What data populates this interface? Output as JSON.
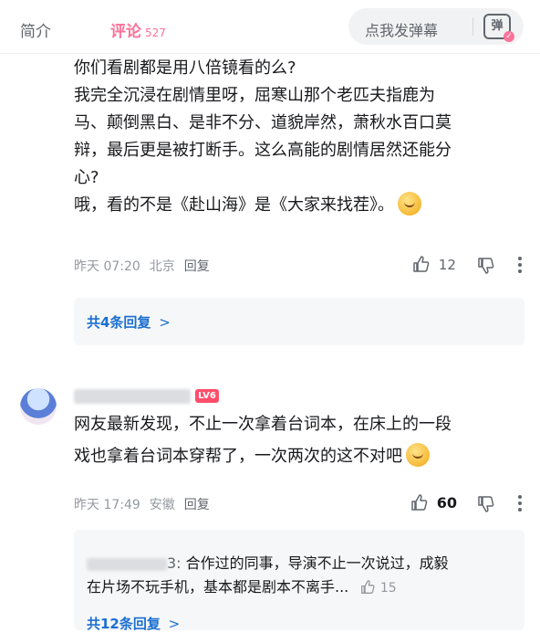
{
  "tabs": {
    "intro": "简介",
    "comments": "评论",
    "comments_count": "527"
  },
  "danmaku": {
    "prompt": "点我发弹幕",
    "icon_label": "弹"
  },
  "comment1": {
    "lines": [
      "你们看剧都是用八倍镜看的么?",
      "我完全沉浸在剧情里呀，屈寒山那个老匹夫指鹿为",
      "马、颠倒黑白、是非不分、道貌岸然，萧秋水百口莫",
      "辩，最后更是被打断手。这么高能的剧情居然还能分",
      "心?",
      "哦，看的不是《赴山海》是《大家来找茬》。"
    ],
    "time": "昨天 07:20",
    "location": "北京",
    "reply_label": "回复",
    "likes": "12",
    "replies_summary": "共4条回复",
    "replies_arrow": ">"
  },
  "comment2": {
    "level": "LV6",
    "lines": [
      "网友最新发现，不止一次拿着台词本，在床上的一段",
      "戏也拿着台词本穿帮了，一次两次的这不对吧"
    ],
    "time": "昨天 17:49",
    "location": "安徽",
    "reply_label": "回复",
    "likes": "60",
    "sub_reply": {
      "author_suffix": "3:",
      "line1": "合作过的同事，导演不止一次说过，成毅",
      "line2": "在片场不玩手机，基本都是剧本不离手...",
      "likes": "15"
    },
    "replies_summary": "共12条回复",
    "replies_arrow": ">"
  },
  "colors": {
    "accent": "#fb7299",
    "link": "#1a6fd1",
    "meta": "#9499a0",
    "reply_bg": "#f6f7f8"
  },
  "icons": [
    "thumb-up-icon",
    "thumb-down-icon",
    "more-vertical-icon",
    "danmaku-icon",
    "chevron-right-icon",
    "emoji-face-icon"
  ]
}
